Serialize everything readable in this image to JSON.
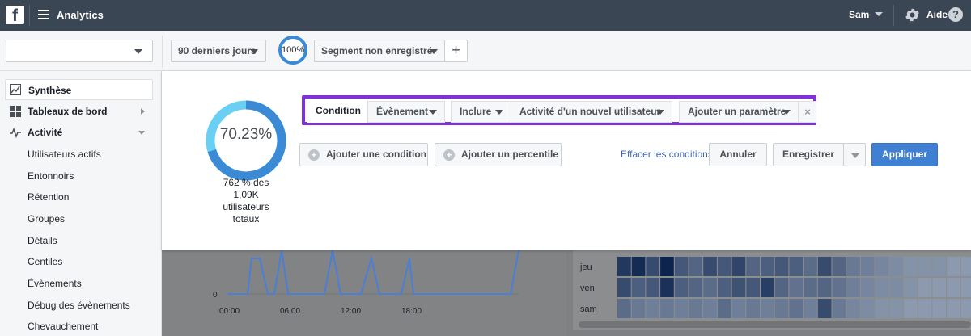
{
  "topbar": {
    "logo_letter": "f",
    "app_title": "Analytics",
    "user_name": "Sam",
    "help_label": "Aide",
    "help_icon_text": "?"
  },
  "filters": {
    "app_selector_value": "",
    "date_range": "90 derniers jours",
    "percent": "100%",
    "segment": "Segment non enregistré",
    "add_label": "+"
  },
  "sidebar": {
    "items": [
      {
        "label": "Synthèse",
        "icon": "chart-icon",
        "active": true
      },
      {
        "label": "Tableaux de bord",
        "icon": "grid-icon"
      },
      {
        "label": "Activité",
        "icon": "pulse-icon",
        "expanded": true
      }
    ],
    "sub_items": [
      "Utilisateurs actifs",
      "Entonnoirs",
      "Rétention",
      "Groupes",
      "Détails",
      "Centiles",
      "Évènements",
      "Débug des évènements",
      "Chevauchement"
    ]
  },
  "segment_editor": {
    "donut_percent": "70.23%",
    "donut_fraction": 0.7023,
    "caption": [
      "762 % des",
      "1,09K",
      "utilisateurs",
      "totaux"
    ],
    "condition": {
      "label": "Condition",
      "event_label": "Évènement",
      "include_label": "Inclure",
      "event_value": "Activité d'un nouvel utilisateur",
      "add_param_label": "Ajouter un paramètre",
      "remove_label": "×"
    },
    "add_condition_label": "Ajouter une condition",
    "add_percentile_label": "Ajouter un percentile",
    "clear_label": "Effacer les conditions",
    "cancel_label": "Annuler",
    "save_label": "Enregistrer",
    "apply_label": "Appliquer"
  },
  "background": {
    "chart": {
      "y_tick": "0",
      "x_ticks": [
        "00:00",
        "06:00",
        "12:00",
        "18:00"
      ]
    },
    "heatmap": {
      "rows": [
        "jeu",
        "ven",
        "sam"
      ],
      "levels": [
        [
          0.85,
          0.95,
          0.7,
          1.0,
          0.6,
          0.5,
          0.7,
          0.6,
          0.75,
          0.5,
          0.55,
          0.6,
          0.55,
          0.45,
          0.7,
          0.5,
          0.35,
          0.3,
          0.25,
          0.2,
          0.15,
          0.15,
          0.15,
          0.1,
          0.1
        ],
        [
          0.7,
          0.55,
          0.6,
          0.9,
          0.55,
          0.5,
          0.45,
          0.55,
          0.65,
          0.6,
          0.8,
          0.5,
          0.4,
          0.45,
          0.5,
          0.4,
          0.3,
          0.25,
          0.2,
          0.2,
          0.15,
          0.1,
          0.1,
          0.1,
          0.1
        ],
        [
          0.45,
          0.35,
          0.3,
          0.35,
          0.3,
          0.35,
          0.3,
          0.45,
          0.3,
          0.35,
          0.3,
          0.35,
          0.4,
          0.3,
          0.7,
          0.35,
          0.25,
          0.2,
          0.15,
          0.15,
          0.1,
          0.1,
          0.1,
          0.1,
          0.1
        ]
      ]
    }
  },
  "colors": {
    "topbar": "#3b4654",
    "accent": "#4080d2",
    "highlight_frame": "#7e32d8",
    "donut_fill": "#3a8ad6",
    "donut_rest": "#6ad0f3"
  }
}
